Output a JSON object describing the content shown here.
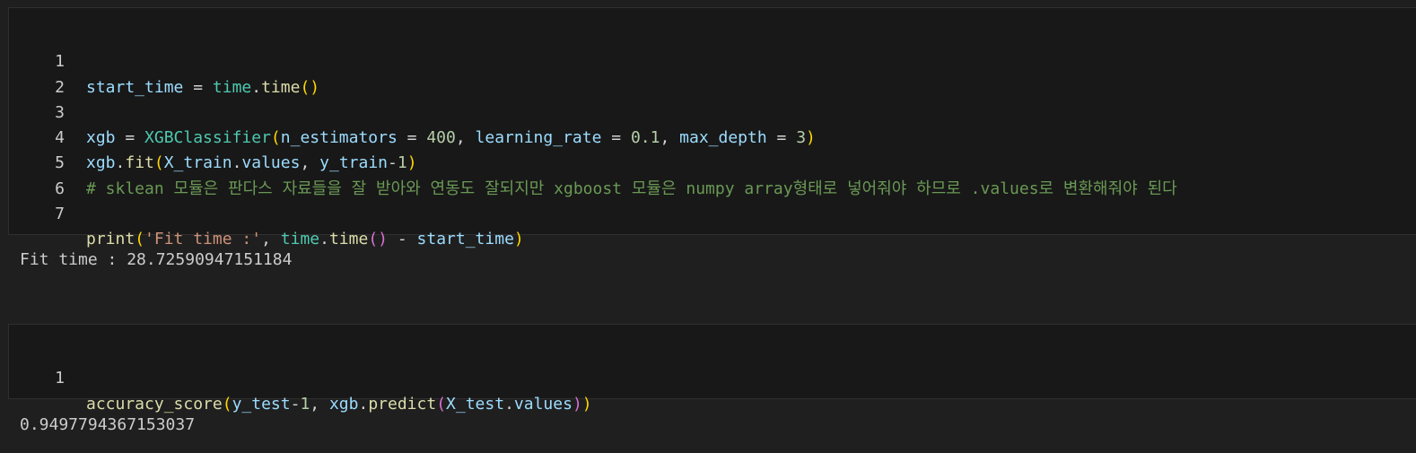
{
  "cells": [
    {
      "lines": [
        {
          "number": "1",
          "tokens": [
            "start_time",
            " = ",
            "time",
            ".",
            "time",
            "()"
          ]
        },
        {
          "number": "2",
          "tokens": []
        },
        {
          "number": "3",
          "tokens": [
            "xgb",
            " = ",
            "XGBClassifier",
            "(",
            "n_estimators",
            " = ",
            "400",
            ", ",
            "learning_rate",
            " = ",
            "0.1",
            ", ",
            "max_depth",
            " = ",
            "3",
            ")"
          ]
        },
        {
          "number": "4",
          "tokens": [
            "xgb",
            ".",
            "fit",
            "(",
            "X_train",
            ".",
            "values",
            ", ",
            "y_train",
            "-",
            "1",
            ")"
          ]
        },
        {
          "number": "5",
          "tokens": [
            "# sklean 모듈은 판다스 자료들을 잘 받아와 연동도 잘되지만 xgboost 모듈은 numpy array형태로 넣어줘야 하므로 .values로 변환해줘야 된다"
          ]
        },
        {
          "number": "6",
          "tokens": []
        },
        {
          "number": "7",
          "tokens": [
            "print",
            "(",
            "'Fit time :'",
            ", ",
            "time",
            ".",
            "time",
            "()",
            " - ",
            "start_time",
            ")"
          ]
        }
      ],
      "output": "Fit time : 28.72590947151184"
    },
    {
      "lines": [
        {
          "number": "1",
          "tokens": [
            "accuracy_score",
            "(",
            "y_test",
            "-",
            "1",
            ", ",
            "xgb",
            ".",
            "predict",
            "(",
            "X_test",
            ".",
            "values",
            ")",
            ")"
          ]
        }
      ],
      "output": "0.9497794367153037"
    }
  ],
  "colors": {
    "background": "#1f1f1f",
    "cell_background": "#181818",
    "variable": "#9cdcfe",
    "class": "#4ec9b0",
    "function": "#dcdcaa",
    "number": "#b5cea8",
    "string": "#ce9178",
    "comment": "#6a9955",
    "bracket_1": "#ffd700",
    "bracket_2": "#da70d6",
    "bracket_3": "#179fff"
  }
}
